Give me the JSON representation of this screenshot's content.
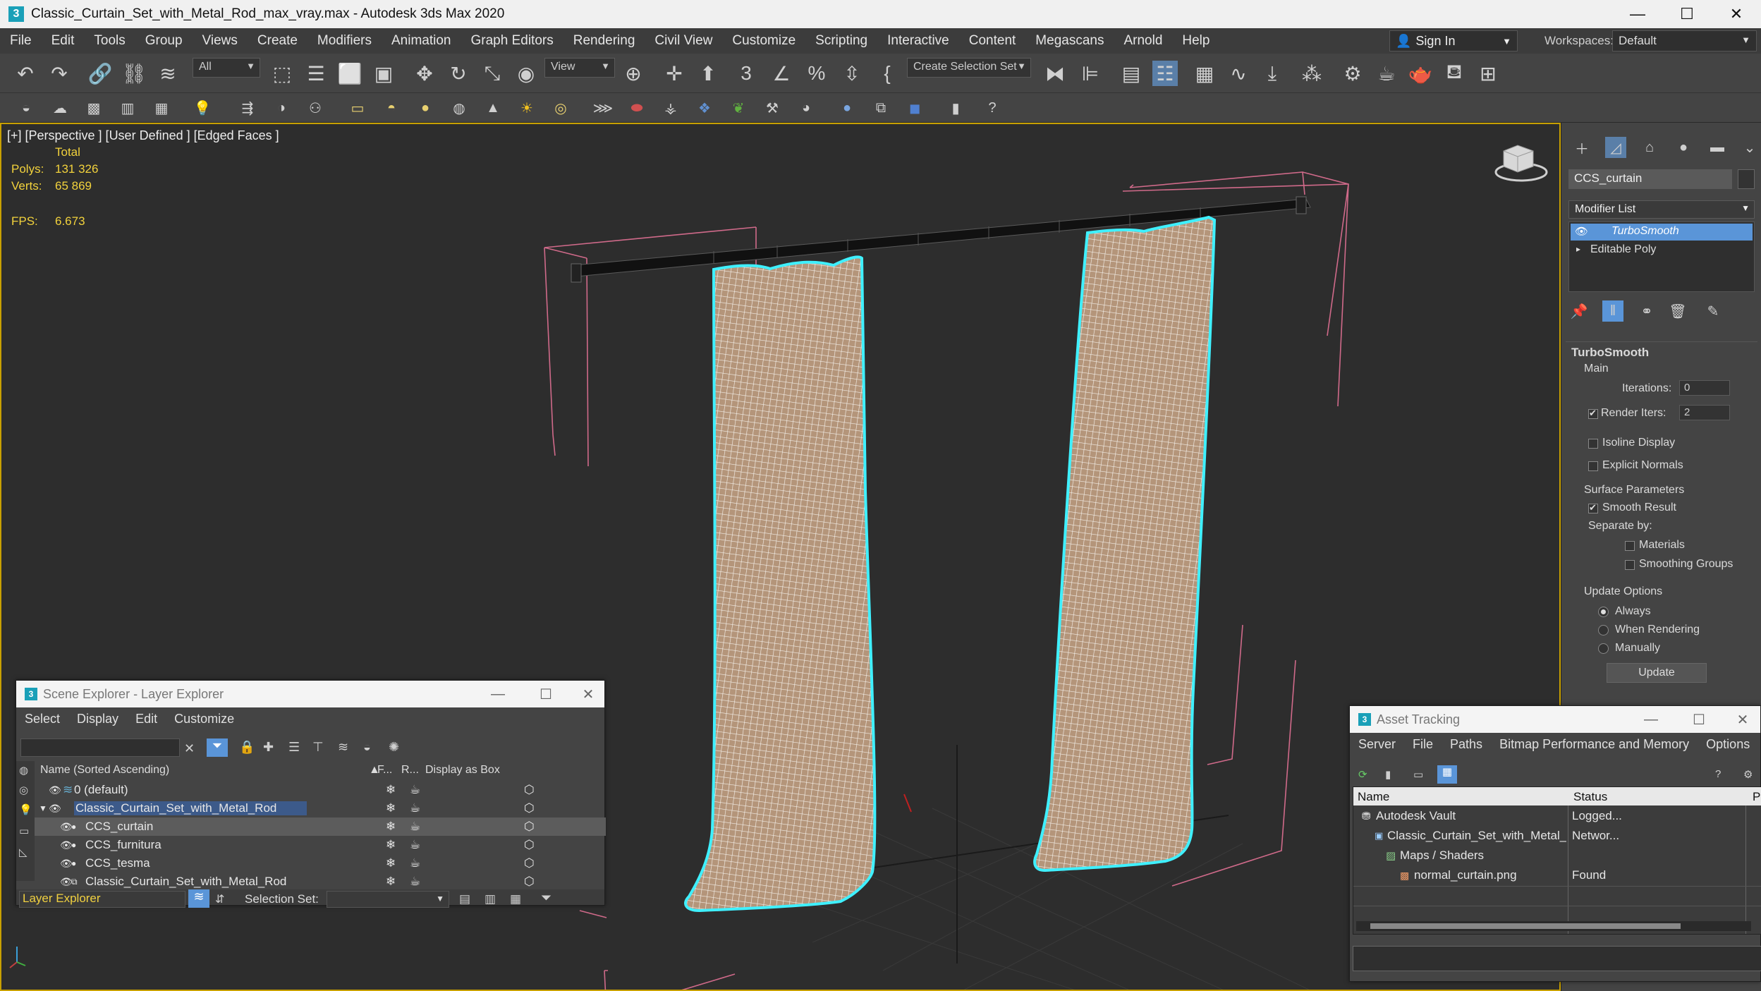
{
  "window": {
    "title": "Classic_Curtain_Set_with_Metal_Rod_max_vray.max - Autodesk 3ds Max 2020",
    "app_icon": "3",
    "minimize": "—",
    "maximize": "☐",
    "close": "✕"
  },
  "menu": [
    "File",
    "Edit",
    "Tools",
    "Group",
    "Views",
    "Create",
    "Modifiers",
    "Animation",
    "Graph Editors",
    "Rendering",
    "Civil View",
    "Customize",
    "Scripting",
    "Interactive",
    "Content",
    "Megascans",
    "Arnold",
    "Help"
  ],
  "account": {
    "sign_in": "Sign In",
    "workspaces_label": "Workspaces:",
    "workspace": "Default"
  },
  "toolbar": {
    "filter_all": "All",
    "ref_coord": "View",
    "selection_set": "Create Selection Set"
  },
  "viewport": {
    "label": "[+] [Perspective ] [User Defined ] [Edged Faces ]",
    "stats_total": "Total",
    "polys_label": "Polys:",
    "polys_value": "131 326",
    "verts_label": "Verts:",
    "verts_value": "65 869",
    "fps_label": "FPS:",
    "fps_value": "6.673"
  },
  "command_panel": {
    "object_name": "CCS_curtain",
    "modifier_list": "Modifier List",
    "stack": [
      "TurboSmooth",
      "Editable Poly"
    ],
    "rollout_title": "TurboSmooth",
    "main": "Main",
    "iterations_label": "Iterations:",
    "iterations_value": "0",
    "render_iters_label": "Render Iters:",
    "render_iters_value": "2",
    "isoline": "Isoline Display",
    "explicit_normals": "Explicit Normals",
    "surface_params": "Surface Parameters",
    "smooth_result": "Smooth Result",
    "separate_by": "Separate by:",
    "materials": "Materials",
    "smoothing_groups": "Smoothing Groups",
    "update_options": "Update Options",
    "always": "Always",
    "when_rendering": "When Rendering",
    "manually": "Manually",
    "update_button": "Update"
  },
  "scene_explorer": {
    "title": "Scene Explorer - Layer Explorer",
    "menu": [
      "Select",
      "Display",
      "Edit",
      "Customize"
    ],
    "col_name": "Name (Sorted Ascending)",
    "col_f": "F...",
    "col_r": "R...",
    "col_box": "Display as Box",
    "rows": [
      "0 (default)",
      "Classic_Curtain_Set_with_Metal_Rod",
      "CCS_curtain",
      "CCS_furnitura",
      "CCS_tesma",
      "Classic_Curtain_Set_with_Metal_Rod"
    ],
    "footer_explorer": "Layer Explorer",
    "selection_set_label": "Selection Set:"
  },
  "asset_tracking": {
    "title": "Asset Tracking",
    "menu": [
      "Server",
      "File",
      "Paths",
      "Bitmap Performance and Memory",
      "Options"
    ],
    "col_name": "Name",
    "col_status": "Status",
    "col_extra": "Pr",
    "rows": [
      {
        "name": "Autodesk Vault",
        "status": "Logged..."
      },
      {
        "name": "Classic_Curtain_Set_with_Metal_Rod_max_vray.max",
        "status": "Networ..."
      },
      {
        "name": "Maps / Shaders",
        "status": ""
      },
      {
        "name": "normal_curtain.png",
        "status": "Found"
      }
    ]
  },
  "colors": {
    "accent": "#4a90d9",
    "selection": "#5aa0e8",
    "viewport_bg": "#2d2d2d",
    "stats": "#f2d23c",
    "wire_highlight": "#3ff0ff"
  }
}
